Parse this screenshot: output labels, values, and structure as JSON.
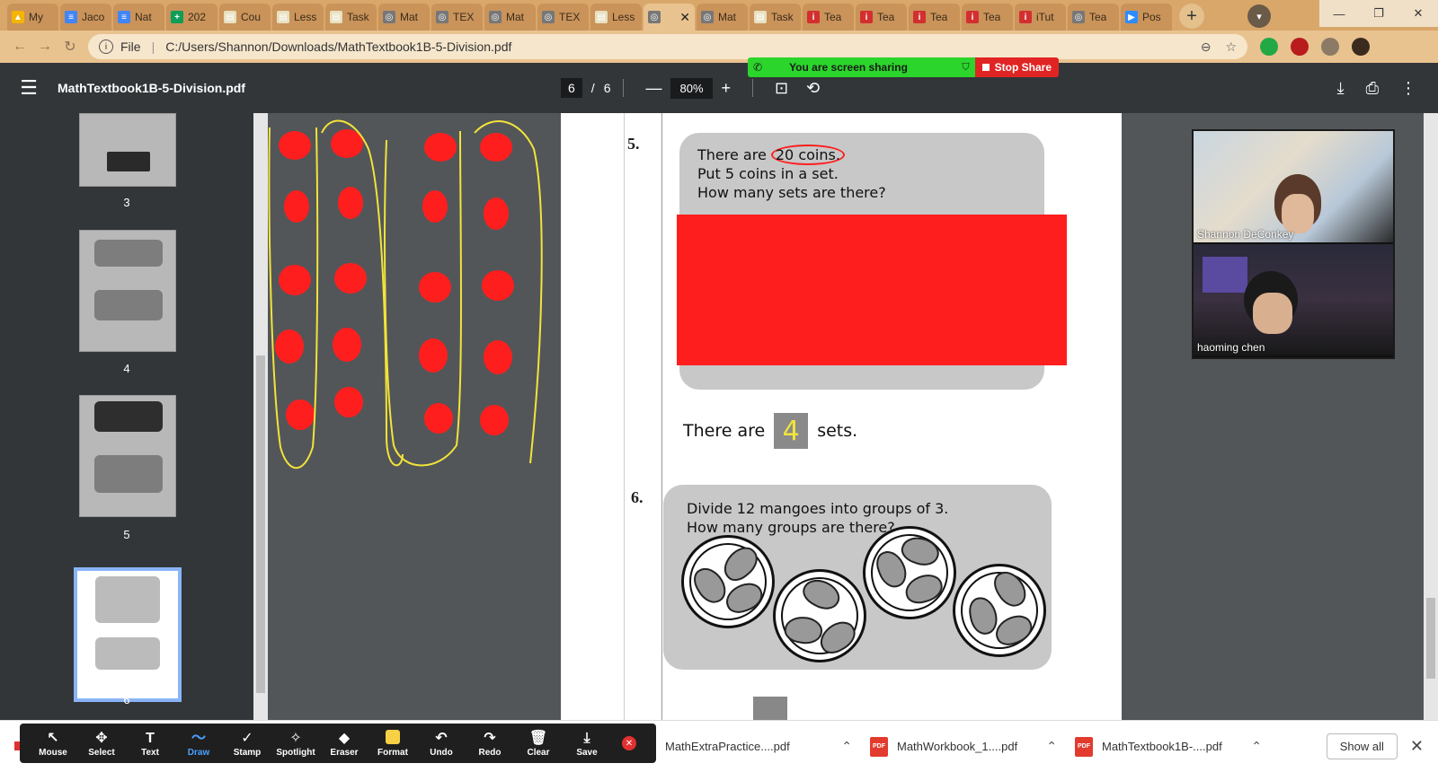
{
  "browser": {
    "tabs": [
      {
        "label": "My",
        "color": "#f4b400",
        "glyph": "▲"
      },
      {
        "label": "Jaco",
        "color": "#4285f4",
        "glyph": "≡"
      },
      {
        "label": "Nat",
        "color": "#4285f4",
        "glyph": "≡"
      },
      {
        "label": "202",
        "color": "#0f9d58",
        "glyph": "+"
      },
      {
        "label": "Cou",
        "color": "#e8e0c0",
        "glyph": "▤"
      },
      {
        "label": "Less",
        "color": "#e8e0c0",
        "glyph": "▤"
      },
      {
        "label": "Task",
        "color": "#e8e0c0",
        "glyph": "▤"
      },
      {
        "label": "Mat",
        "color": "#777777",
        "glyph": "◎"
      },
      {
        "label": "TEX",
        "color": "#777777",
        "glyph": "◎"
      },
      {
        "label": "Mat",
        "color": "#777777",
        "glyph": "◎"
      },
      {
        "label": "TEX",
        "color": "#777777",
        "glyph": "◎"
      },
      {
        "label": "Less",
        "color": "#e8e0c0",
        "glyph": "▤"
      },
      {
        "label": "",
        "color": "#777777",
        "glyph": "◎",
        "active": true
      },
      {
        "label": "Mat",
        "color": "#777777",
        "glyph": "◎"
      },
      {
        "label": "Task",
        "color": "#e8e0c0",
        "glyph": "▤"
      },
      {
        "label": "Tea",
        "color": "#d32f2f",
        "glyph": "i"
      },
      {
        "label": "Tea",
        "color": "#d32f2f",
        "glyph": "i"
      },
      {
        "label": "Tea",
        "color": "#d32f2f",
        "glyph": "i"
      },
      {
        "label": "Tea",
        "color": "#d32f2f",
        "glyph": "i"
      },
      {
        "label": "iTut",
        "color": "#d32f2f",
        "glyph": "i"
      },
      {
        "label": "Tea",
        "color": "#777777",
        "glyph": "◎"
      },
      {
        "label": "Pos",
        "color": "#2d8cff",
        "glyph": "▶"
      }
    ],
    "active_close": "✕",
    "new_tab": "+",
    "address": {
      "scheme_label": "File",
      "url": "C:/Users/Shannon/Downloads/MathTextbook1B-5-Division.pdf"
    }
  },
  "share_banner": {
    "message": "You are screen sharing",
    "stop_label": "Stop Share"
  },
  "pdf_toolbar": {
    "title": "MathTextbook1B-5-Division.pdf",
    "current_page": "6",
    "page_sep": "/",
    "total_pages": "6",
    "zoom": "80%",
    "zoom_out": "—",
    "zoom_in": "+"
  },
  "sidebar": {
    "pages": [
      "3",
      "4",
      "5",
      "6"
    ]
  },
  "page": {
    "q5_num": "5.",
    "q5_line1_a": "There are ",
    "q5_line1_b": "20 coins.",
    "q5_line2": "Put 5 coins in a set.",
    "q5_line3": "How many sets are there?",
    "answer_prefix": "There are",
    "answer_value": "4",
    "answer_suffix": "sets.",
    "q6_num": "6.",
    "q6_line1": "Divide 12 mangoes into groups of 3.",
    "q6_line2": "How many groups are there?"
  },
  "video": {
    "participants": [
      "Shannon DeConkey",
      "haoming chen"
    ]
  },
  "annotate_toolbar": {
    "tools": [
      {
        "label": "Mouse",
        "glyph": "↖"
      },
      {
        "label": "Select",
        "glyph": "✥"
      },
      {
        "label": "Text",
        "glyph": "T"
      },
      {
        "label": "Draw",
        "glyph": "〜",
        "selected": true
      },
      {
        "label": "Stamp",
        "glyph": "✓"
      },
      {
        "label": "Spotlight",
        "glyph": "✧"
      },
      {
        "label": "Eraser",
        "glyph": "◆"
      },
      {
        "label": "Format",
        "glyph": "■"
      },
      {
        "label": "Undo",
        "glyph": "↶"
      },
      {
        "label": "Redo",
        "glyph": "↷"
      },
      {
        "label": "Clear",
        "glyph": "🗑"
      },
      {
        "label": "Save",
        "glyph": "⤓"
      }
    ],
    "format_color": "#f7d046"
  },
  "downloads": {
    "items": [
      "MathExtraPractice....pdf",
      "MathWorkbook_1....pdf",
      "MathTextbook1B-....pdf"
    ],
    "show_all": "Show all",
    "pdf_badge": "PDF"
  },
  "colors": {
    "annotation_red": "#ff1e1e",
    "annotation_yellow": "#f2e33a"
  }
}
